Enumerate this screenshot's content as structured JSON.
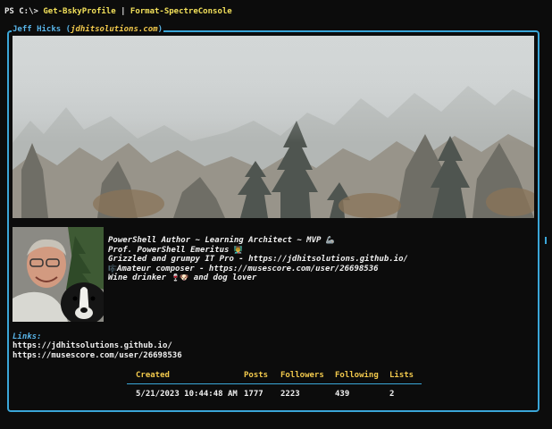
{
  "terminal": {
    "prompt": "PS C:\\>",
    "command": "Get-BskyProfile",
    "pipe": "|",
    "command2": "Format-SpectreConsole"
  },
  "profile": {
    "display_name": "Jeff Hicks",
    "handle": "jdhitsolutions.com",
    "bio_lines": [
      "PowerShell Author ~ Learning Architect ~ MVP",
      "Prof. PowerShell Emeritus",
      "Grizzled and grumpy IT Pro - https://jdhitsolutions.github.io/",
      "Amateur composer - https://musescore.com/user/26698536",
      "Wine drinker",
      "and dog lover"
    ],
    "bio_emoji": [
      "🦾",
      "👨‍🏫",
      "🎼",
      "🍷🐶"
    ],
    "links_label": "Links:",
    "links": [
      "https://jdhitsolutions.github.io/",
      "https://musescore.com/user/26698536"
    ]
  },
  "stats": {
    "headers": [
      "Created",
      "Posts",
      "Followers",
      "Following",
      "Lists"
    ],
    "values": [
      "5/21/2023 10:44:48 AM",
      "1777",
      "2223",
      "439",
      "2"
    ]
  },
  "colors": {
    "border": "#3aa6d8",
    "header_text": "#f2c94c",
    "command": "#f2e05a",
    "background": "#0c0c0c"
  }
}
